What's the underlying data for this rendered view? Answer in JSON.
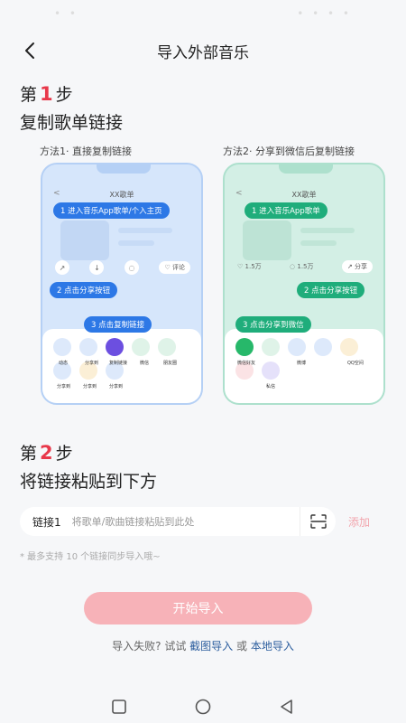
{
  "header": {
    "title": "导入外部音乐"
  },
  "step1": {
    "prefix": "第",
    "number": "1",
    "suffix": "步",
    "description": "复制歌单链接"
  },
  "method1": {
    "label": "方法1· 直接复制链接",
    "phone_title": "XX歌单",
    "pill1": "1 进入音乐App歌单/个入主页",
    "pill2": "2 点击分享按钮",
    "pill3": "3 点击复制链接",
    "comment_label": "评论",
    "share_labels": [
      "动态",
      "分享到",
      "复制链接",
      "微信",
      "朋友圈",
      "分享到",
      "分享到",
      "分享到"
    ]
  },
  "method2": {
    "label": "方法2· 分享到微信后复制链接",
    "phone_title": "XX歌单",
    "pill1": "1 进入音乐App歌单",
    "pill2": "2 点击分享按钮",
    "pill3": "3 点击分享到微信",
    "count1": "1.5万",
    "count2": "1.5万",
    "share_btn": "分享",
    "share_labels": [
      "微信好友",
      "",
      "微博",
      "",
      "QQ空间",
      "",
      "私信"
    ]
  },
  "step2": {
    "prefix": "第",
    "number": "2",
    "suffix": "步",
    "description": "将链接粘贴到下方"
  },
  "input": {
    "label": "链接1",
    "placeholder": "将歌单/歌曲链接粘贴到此处",
    "value": ""
  },
  "add_label": "添加",
  "hint": "* 最多支持 10 个链接同步导入哦~",
  "start_button": "开始导入",
  "fail": {
    "prefix": "导入失败? 试试",
    "link1": "截图导入",
    "or": "或",
    "link2": "本地导入"
  }
}
